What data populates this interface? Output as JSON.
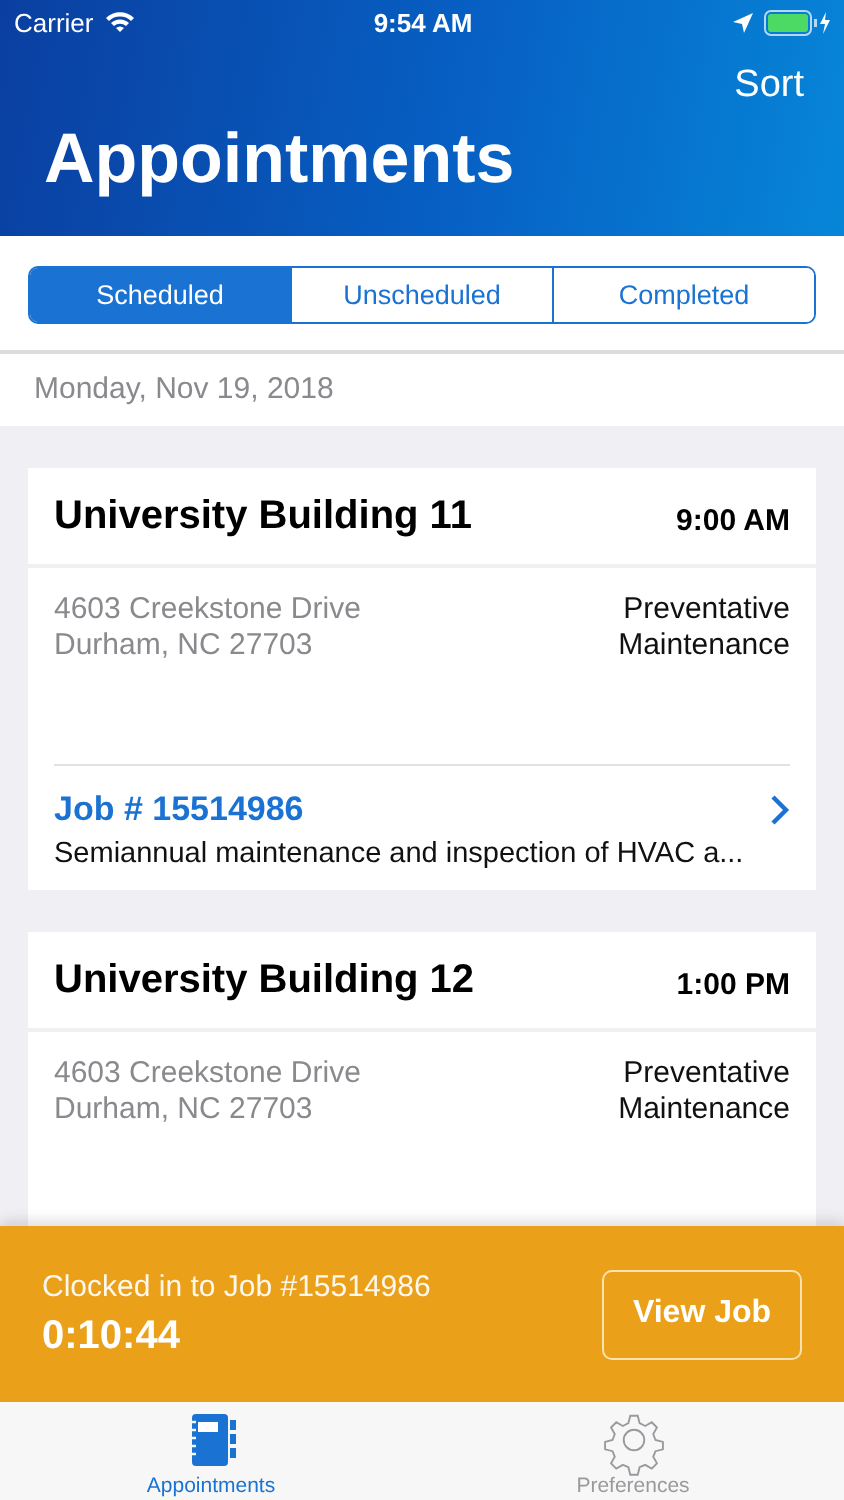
{
  "status_bar": {
    "carrier": "Carrier",
    "time": "9:54 AM"
  },
  "header": {
    "action": "Sort",
    "title": "Appointments"
  },
  "tabs": [
    {
      "label": "Scheduled",
      "selected": true
    },
    {
      "label": "Unscheduled",
      "selected": false
    },
    {
      "label": "Completed",
      "selected": false
    }
  ],
  "date": "Monday, Nov 19, 2018",
  "appointments": [
    {
      "name": "University Building 11",
      "time": "9:00 AM",
      "address": [
        "4603 Creekstone Drive",
        "Durham, NC 27703"
      ],
      "type": [
        "Preventative",
        "Maintenance"
      ],
      "job": {
        "number": "Job # 15514986",
        "description": "Semiannual maintenance and inspection of HVAC a..."
      }
    },
    {
      "name": "University Building 12",
      "time": "1:00 PM",
      "address": [
        "4603 Creekstone Drive",
        "Durham, NC 27703"
      ],
      "type": [
        "Preventative",
        "Maintenance"
      ]
    }
  ],
  "clock_banner": {
    "message": "Clocked in to Job #15514986",
    "timer": "0:10:44",
    "button": "View Job"
  },
  "tab_bar": [
    {
      "label": "Appointments",
      "kind": "notebook",
      "selected": true
    },
    {
      "label": "Preferences",
      "kind": "gear",
      "selected": false
    }
  ]
}
